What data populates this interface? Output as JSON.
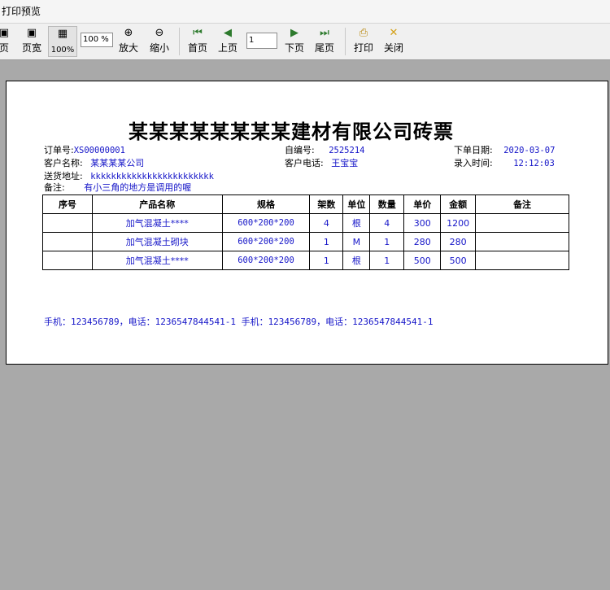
{
  "window": {
    "title": "打印预览"
  },
  "toolbar": {
    "single_page_label": "页",
    "page_width_label": "页宽",
    "zoom_100_label": "100%",
    "zoom_value": "100 %",
    "zoom_in_label": "放大",
    "zoom_out_label": "缩小",
    "first_page_label": "首页",
    "prev_page_label": "上页",
    "page_number": "1",
    "next_page_label": "下页",
    "last_page_label": "尾页",
    "print_label": "打印",
    "close_label": "关闭"
  },
  "document": {
    "title": "某某某某某某某某建材有限公司砖票",
    "order_no_label": "订单号:",
    "order_no": "XS00000001",
    "serial_label": "自编号:",
    "serial": "2525214",
    "order_date_label": "下单日期:",
    "order_date": "2020-03-07",
    "customer_label": "客户名称:",
    "customer": "某某某某公司",
    "phone_label": "客户电话:",
    "phone": "王宝宝",
    "entry_time_label": "录入时间:",
    "entry_time": "12:12:03",
    "address_label": "送货地址:",
    "address": "kkkkkkkkkkkkkkkkkkkkkkkk",
    "remark_label": "备注:",
    "remark": "有小三角的地方是调用的喔",
    "table": {
      "headers": [
        "序号",
        "产品名称",
        "规格",
        "架数",
        "单位",
        "数量",
        "单价",
        "金额",
        "备注"
      ],
      "rows": [
        [
          "",
          "加气混凝土****",
          "600*200*200",
          "4",
          "根",
          "4",
          "300",
          "1200",
          ""
        ],
        [
          "",
          "加气混凝土砌块",
          "600*200*200",
          "1",
          "M",
          "1",
          "280",
          "280",
          ""
        ],
        [
          "",
          "加气混凝土****",
          "600*200*200",
          "1",
          "根",
          "1",
          "500",
          "500",
          ""
        ]
      ]
    },
    "footer": "手机：123456789，电话：1236547844541-1 手机：123456789，电话：1236547844541-1"
  }
}
